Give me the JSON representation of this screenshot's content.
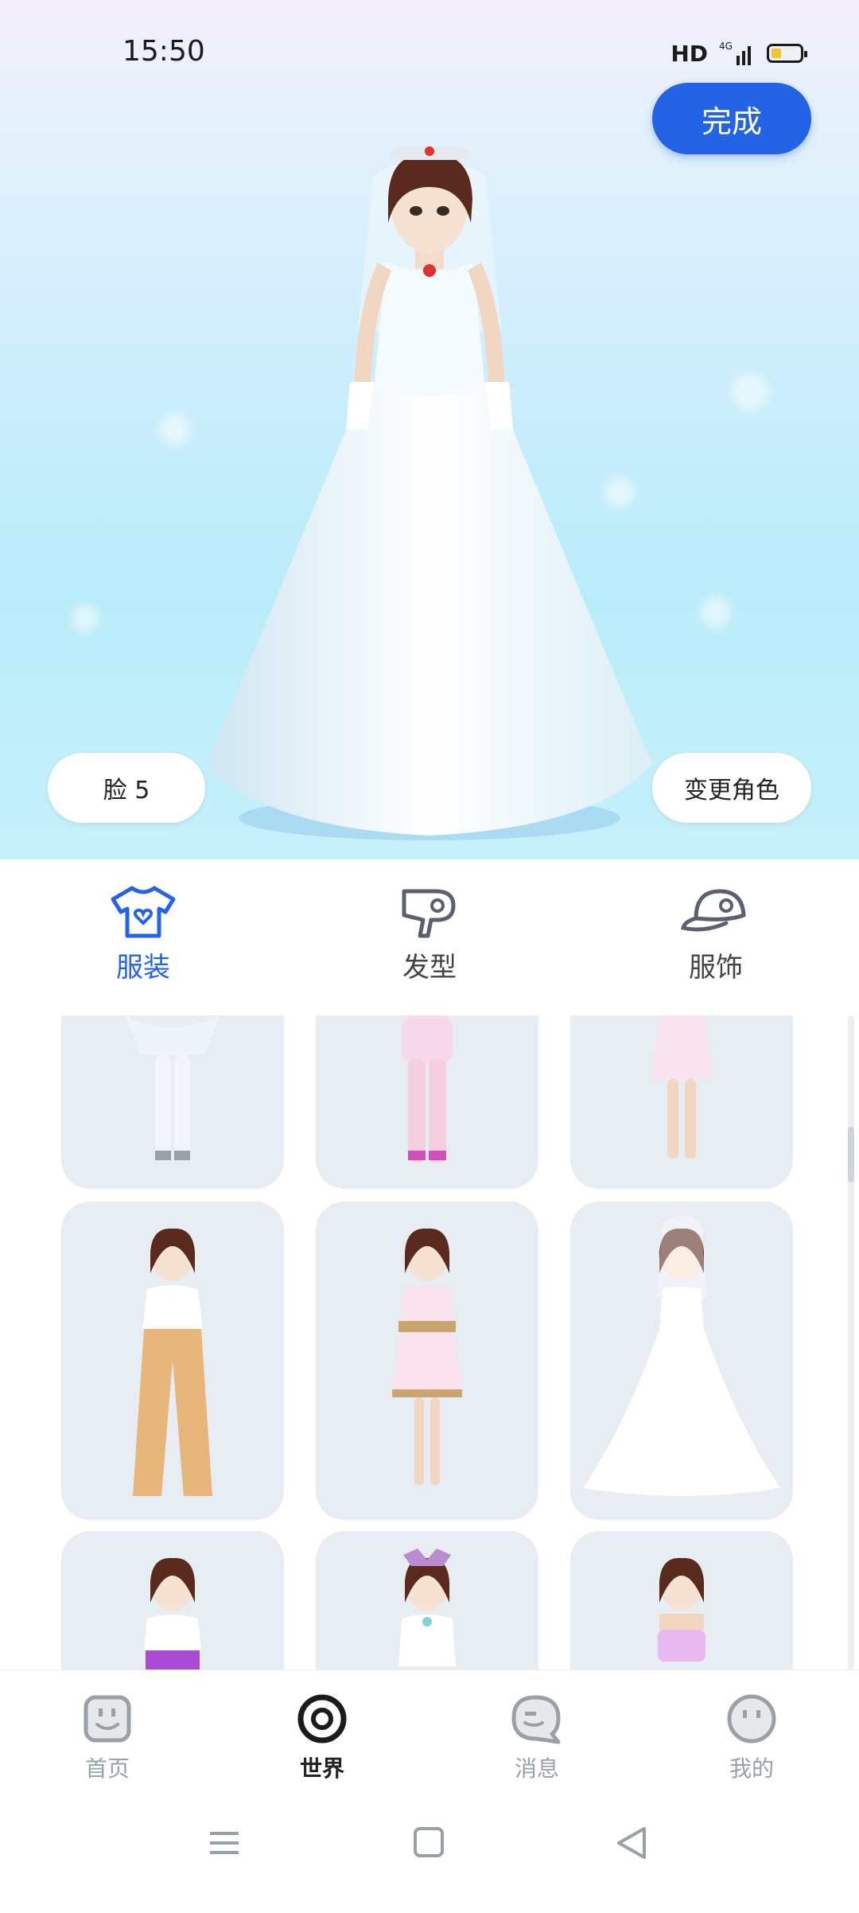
{
  "status": {
    "time": "15:50",
    "network": "HD"
  },
  "header": {
    "done_label": "完成"
  },
  "stage": {
    "face_label": "脸 5",
    "change_label": "变更角色"
  },
  "tabs": [
    {
      "label": "服装",
      "icon": "tshirt-icon",
      "active": true
    },
    {
      "label": "发型",
      "icon": "hair-dryer-icon",
      "active": false
    },
    {
      "label": "服饰",
      "icon": "cap-icon",
      "active": false
    }
  ],
  "outfits": [
    {
      "name": "white-pants"
    },
    {
      "name": "pink-pajama"
    },
    {
      "name": "pink-dress"
    },
    {
      "name": "tan-flare-pants"
    },
    {
      "name": "layered-pink-dress"
    },
    {
      "name": "wedding-gown"
    },
    {
      "name": "purple-skirt"
    },
    {
      "name": "sailor-uniform"
    },
    {
      "name": "lavender-top"
    }
  ],
  "bottom_nav": [
    {
      "label": "首页",
      "icon": "home-face-icon",
      "active": false
    },
    {
      "label": "世界",
      "icon": "world-ring-icon",
      "active": true
    },
    {
      "label": "消息",
      "icon": "message-bubble-icon",
      "active": false
    },
    {
      "label": "我的",
      "icon": "profile-face-icon",
      "active": false
    }
  ],
  "colors": {
    "accent": "#2462e6",
    "card_bg": "#e8ecf3",
    "hero_bg": "#cfeefc"
  }
}
